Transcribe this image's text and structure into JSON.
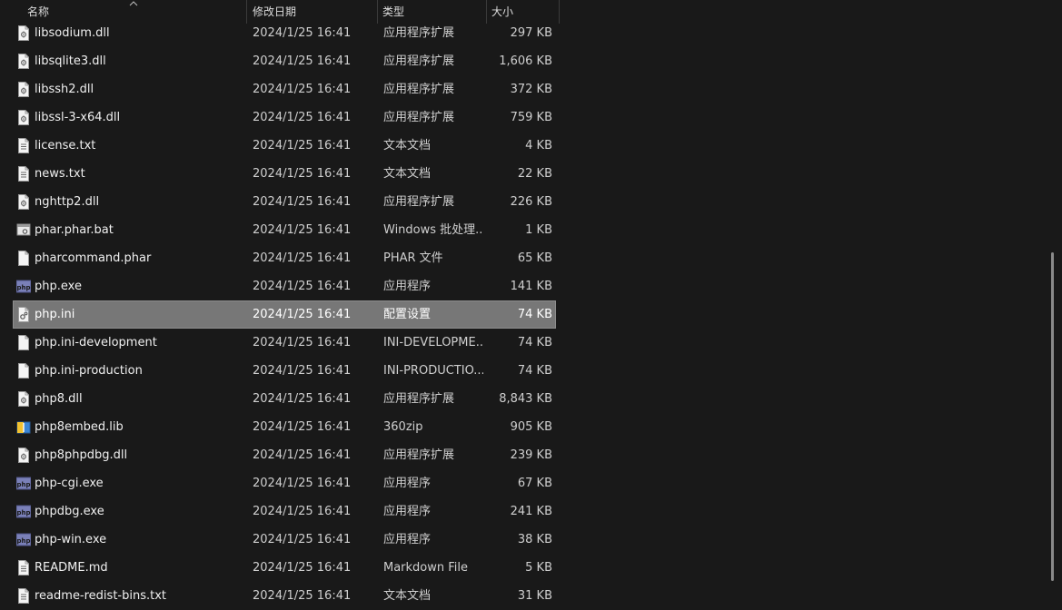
{
  "columns": {
    "name": "名称",
    "date": "修改日期",
    "type": "类型",
    "size": "大小"
  },
  "sort_icon": "chevron-up-icon",
  "files": [
    {
      "name": "libsodium.dll",
      "date": "2024/1/25 16:41",
      "type": "应用程序扩展",
      "size": "297 KB",
      "icon": "dll-file-icon"
    },
    {
      "name": "libsqlite3.dll",
      "date": "2024/1/25 16:41",
      "type": "应用程序扩展",
      "size": "1,606 KB",
      "icon": "dll-file-icon"
    },
    {
      "name": "libssh2.dll",
      "date": "2024/1/25 16:41",
      "type": "应用程序扩展",
      "size": "372 KB",
      "icon": "dll-file-icon"
    },
    {
      "name": "libssl-3-x64.dll",
      "date": "2024/1/25 16:41",
      "type": "应用程序扩展",
      "size": "759 KB",
      "icon": "dll-file-icon"
    },
    {
      "name": "license.txt",
      "date": "2024/1/25 16:41",
      "type": "文本文档",
      "size": "4 KB",
      "icon": "text-file-icon"
    },
    {
      "name": "news.txt",
      "date": "2024/1/25 16:41",
      "type": "文本文档",
      "size": "22 KB",
      "icon": "text-file-icon"
    },
    {
      "name": "nghttp2.dll",
      "date": "2024/1/25 16:41",
      "type": "应用程序扩展",
      "size": "226 KB",
      "icon": "dll-file-icon"
    },
    {
      "name": "phar.phar.bat",
      "date": "2024/1/25 16:41",
      "type": "Windows 批处理...",
      "size": "1 KB",
      "icon": "batch-file-icon"
    },
    {
      "name": "pharcommand.phar",
      "date": "2024/1/25 16:41",
      "type": "PHAR 文件",
      "size": "65 KB",
      "icon": "blank-file-icon"
    },
    {
      "name": "php.exe",
      "date": "2024/1/25 16:41",
      "type": "应用程序",
      "size": "141 KB",
      "icon": "php-exe-icon"
    },
    {
      "name": "php.ini",
      "date": "2024/1/25 16:41",
      "type": "配置设置",
      "size": "74 KB",
      "icon": "config-file-icon",
      "selected": true
    },
    {
      "name": "php.ini-development",
      "date": "2024/1/25 16:41",
      "type": "INI-DEVELOPME...",
      "size": "74 KB",
      "icon": "blank-file-icon"
    },
    {
      "name": "php.ini-production",
      "date": "2024/1/25 16:41",
      "type": "INI-PRODUCTIO...",
      "size": "74 KB",
      "icon": "blank-file-icon"
    },
    {
      "name": "php8.dll",
      "date": "2024/1/25 16:41",
      "type": "应用程序扩展",
      "size": "8,843 KB",
      "icon": "dll-file-icon"
    },
    {
      "name": "php8embed.lib",
      "date": "2024/1/25 16:41",
      "type": "360zip",
      "size": "905 KB",
      "icon": "zip-archive-icon"
    },
    {
      "name": "php8phpdbg.dll",
      "date": "2024/1/25 16:41",
      "type": "应用程序扩展",
      "size": "239 KB",
      "icon": "dll-file-icon"
    },
    {
      "name": "php-cgi.exe",
      "date": "2024/1/25 16:41",
      "type": "应用程序",
      "size": "67 KB",
      "icon": "php-exe-icon"
    },
    {
      "name": "phpdbg.exe",
      "date": "2024/1/25 16:41",
      "type": "应用程序",
      "size": "241 KB",
      "icon": "php-exe-icon"
    },
    {
      "name": "php-win.exe",
      "date": "2024/1/25 16:41",
      "type": "应用程序",
      "size": "38 KB",
      "icon": "php-exe-icon"
    },
    {
      "name": "README.md",
      "date": "2024/1/25 16:41",
      "type": "Markdown File",
      "size": "5 KB",
      "icon": "text-file-icon"
    },
    {
      "name": "readme-redist-bins.txt",
      "date": "2024/1/25 16:41",
      "type": "文本文档",
      "size": "31 KB",
      "icon": "text-file-icon"
    }
  ],
  "colors": {
    "background": "#191919",
    "selection": "#777777",
    "text": "#f0f0f0",
    "php_icon": "#7a80b8"
  }
}
